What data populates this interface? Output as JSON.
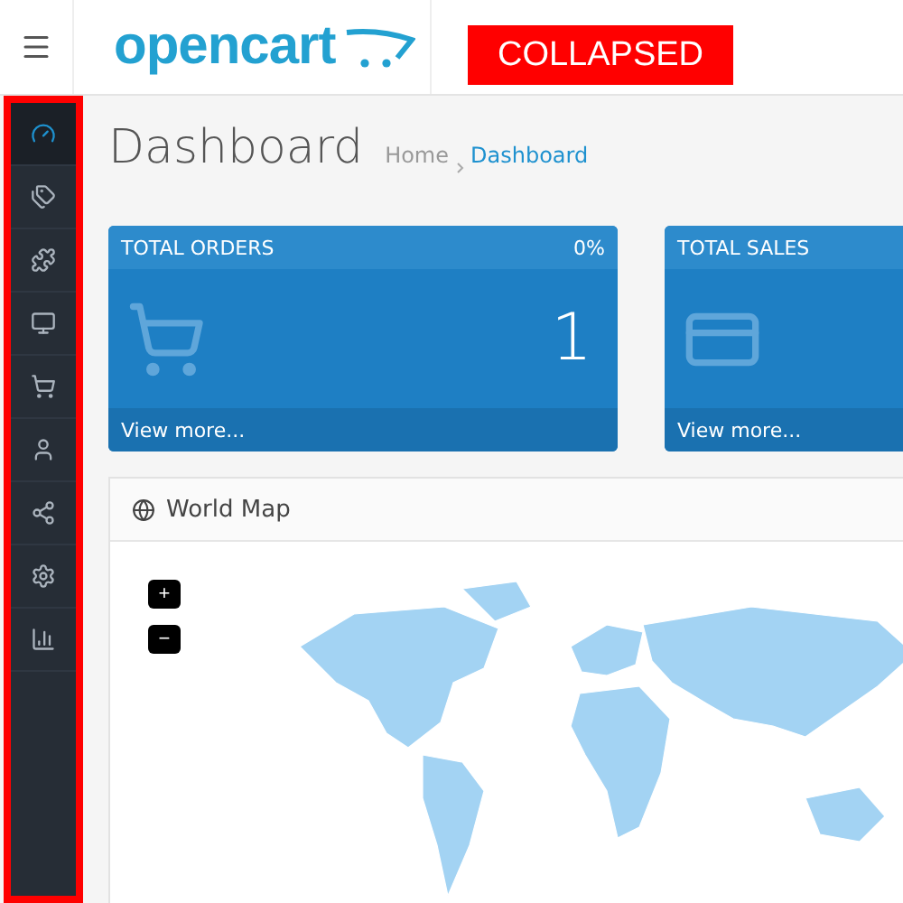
{
  "header": {
    "logo": "opencart",
    "badge": "COLLAPSED"
  },
  "sidebar": {
    "items": [
      {
        "selected": true
      },
      {
        "selected": false
      },
      {
        "selected": false
      },
      {
        "selected": false
      },
      {
        "selected": false
      },
      {
        "selected": false
      },
      {
        "selected": false
      },
      {
        "selected": false
      },
      {
        "selected": false
      }
    ]
  },
  "page": {
    "title": "Dashboard",
    "breadcrumb": [
      {
        "label": "Home",
        "selected": false
      },
      {
        "label": "Dashboard",
        "selected": true
      }
    ]
  },
  "tiles": [
    {
      "title": "TOTAL ORDERS",
      "percent": "0%",
      "value": "1",
      "link": "View more..."
    },
    {
      "title": "TOTAL SALES",
      "link": "View more..."
    }
  ],
  "map_panel": {
    "title": "World Map",
    "zoom_in": "+",
    "zoom_out": "−"
  }
}
